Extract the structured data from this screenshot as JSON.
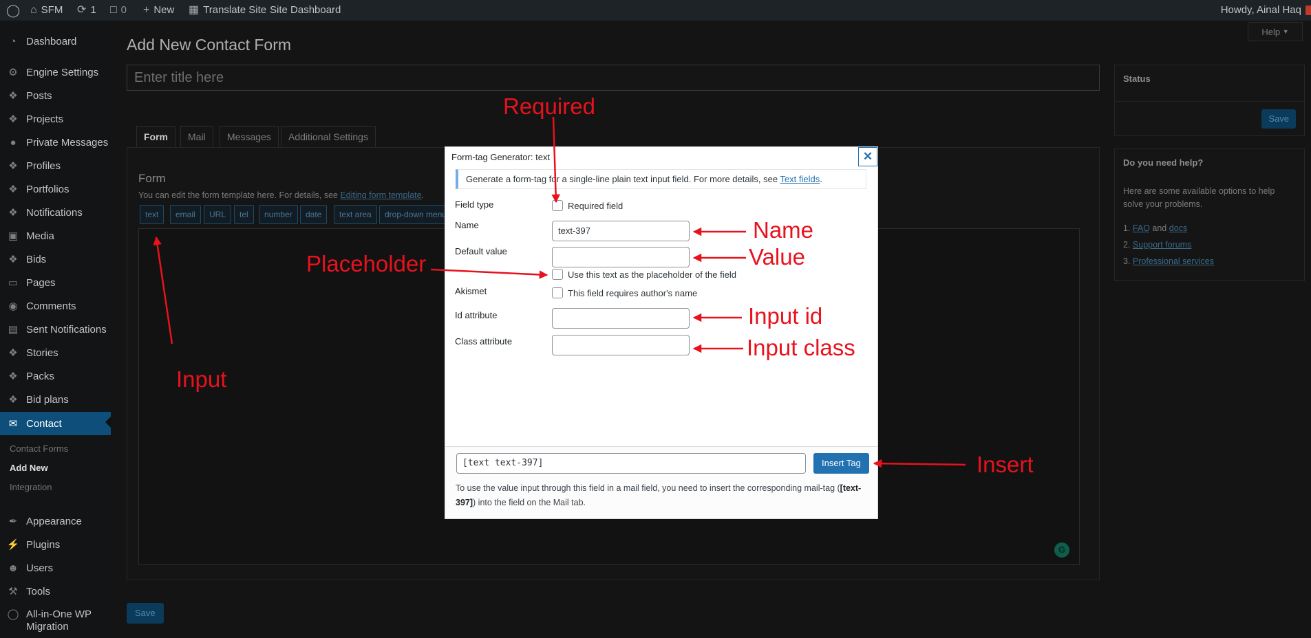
{
  "adminbar": {
    "site_name": "SFM",
    "updates_count": "1",
    "comments_count": "0",
    "new_label": "New",
    "translate_label": "Translate Site",
    "dashboard_label": "Site Dashboard",
    "greeting": "Howdy, Ainal Haq"
  },
  "sidebar": {
    "items": [
      {
        "label": "Dashboard",
        "icon": "gauge-icon"
      },
      {
        "label": "Engine Settings",
        "icon": "gear-icon"
      },
      {
        "label": "Posts",
        "icon": "pin-icon"
      },
      {
        "label": "Projects",
        "icon": "pin-icon"
      },
      {
        "label": "Private Messages",
        "icon": "chat-icon"
      },
      {
        "label": "Profiles",
        "icon": "pin-icon"
      },
      {
        "label": "Portfolios",
        "icon": "pin-icon"
      },
      {
        "label": "Notifications",
        "icon": "pin-icon"
      },
      {
        "label": "Media",
        "icon": "media-icon"
      },
      {
        "label": "Bids",
        "icon": "pin-icon"
      },
      {
        "label": "Pages",
        "icon": "page-icon"
      },
      {
        "label": "Comments",
        "icon": "comment-icon"
      },
      {
        "label": "Sent Notifications",
        "icon": "document-icon"
      },
      {
        "label": "Stories",
        "icon": "pin-icon"
      },
      {
        "label": "Packs",
        "icon": "pin-icon"
      },
      {
        "label": "Bid plans",
        "icon": "pin-icon"
      },
      {
        "label": "Contact",
        "icon": "mail-icon"
      }
    ],
    "submenu": [
      "Contact Forms",
      "Add New",
      "Integration"
    ],
    "bottom_items": [
      {
        "label": "Appearance",
        "icon": "brush-icon"
      },
      {
        "label": "Plugins",
        "icon": "plug-icon"
      },
      {
        "label": "Users",
        "icon": "user-icon"
      },
      {
        "label": "Tools",
        "icon": "wrench-icon"
      },
      {
        "label": "All-in-One WP Migration",
        "icon": "migration-icon"
      }
    ]
  },
  "page": {
    "title": "Add New Contact Form",
    "help_label": "Help",
    "title_placeholder": "Enter title here",
    "tabs": [
      "Form",
      "Mail",
      "Messages",
      "Additional Settings"
    ],
    "form_heading": "Form",
    "form_desc": "You can edit the form template here. For details, see",
    "form_desc_link": "Editing form template",
    "tag_buttons": [
      "text",
      "email",
      "URL",
      "tel",
      "number",
      "date",
      "text area",
      "drop-down menu"
    ],
    "save_label": "Save"
  },
  "status_box": {
    "title": "Status",
    "save_label": "Save"
  },
  "help_box": {
    "title": "Do you need help?",
    "desc": "Here are some available options to help solve your problems.",
    "item1_a": "FAQ",
    "item1_and": "and",
    "item1_b": "docs",
    "item2": "Support forums",
    "item3": "Professional services"
  },
  "modal": {
    "title": "Form-tag Generator: text",
    "notice": "Generate a form-tag for a single-line plain text input field. For more details, see",
    "notice_link": "Text fields",
    "field_type_label": "Field type",
    "required_label": "Required field",
    "name_label": "Name",
    "name_value": "text-397",
    "default_value_label": "Default value",
    "default_value": "",
    "placeholder_label": "Use this text as the placeholder of the field",
    "akismet_label": "Akismet",
    "akismet_option": "This field requires author's name",
    "id_label": "Id attribute",
    "id_value": "",
    "class_label": "Class attribute",
    "class_value": "",
    "tag_output": "[text text-397]",
    "insert_label": "Insert Tag",
    "footer_note_1": "To use the value input through this field in a mail field, you need to insert the corresponding mail-tag (",
    "footer_mailtag": "[text-397]",
    "footer_note_2": ") into the field on the Mail tab."
  },
  "annotations": {
    "required": "Required",
    "name": "Name",
    "value": "Value",
    "placeholder": "Placeholder",
    "input_id": "Input id",
    "input_class": "Input class",
    "input": "Input",
    "insert": "Insert"
  },
  "colors": {
    "annotation_red": "#e8121d",
    "wp_blue": "#2271b1",
    "adminbar_bg": "#1d2327",
    "active_menu": "#0d4f7a"
  }
}
